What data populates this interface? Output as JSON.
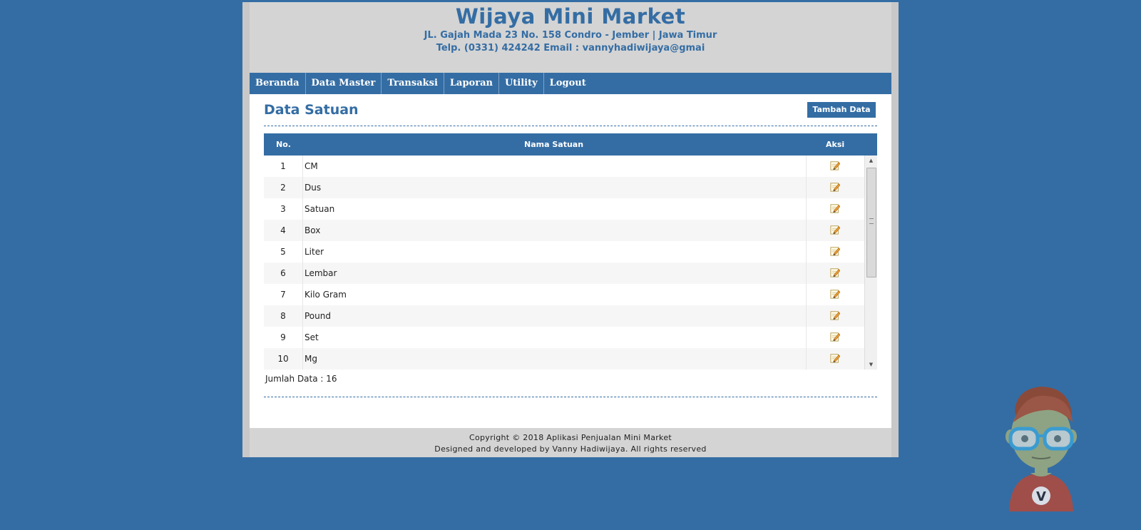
{
  "header": {
    "title": "Wijaya Mini Market",
    "address": "JL. Gajah Mada 23 No. 158 Condro - Jember | Jawa Timur",
    "contact": "Telp. (0331) 424242 Email : vannyhadiwijaya@gmai"
  },
  "nav": [
    "Beranda",
    "Data Master",
    "Transaksi",
    "Laporan",
    "Utility",
    "Logout"
  ],
  "page": {
    "title": "Data Satuan",
    "add_button": "Tambah Data"
  },
  "table": {
    "columns": [
      "No.",
      "Nama Satuan",
      "Aksi"
    ],
    "rows": [
      {
        "no": "1",
        "name": "CM"
      },
      {
        "no": "2",
        "name": "Dus"
      },
      {
        "no": "3",
        "name": "Satuan"
      },
      {
        "no": "4",
        "name": "Box"
      },
      {
        "no": "5",
        "name": "Liter"
      },
      {
        "no": "6",
        "name": "Lembar"
      },
      {
        "no": "7",
        "name": "Kilo Gram"
      },
      {
        "no": "8",
        "name": "Pound"
      },
      {
        "no": "9",
        "name": "Set"
      },
      {
        "no": "10",
        "name": "Mg"
      }
    ]
  },
  "summary": "Jumlah Data : 16",
  "footer": {
    "line1": "Copyright © 2018 Aplikasi Penjualan Mini Market",
    "line2": "Designed and developed by Vanny Hadiwijaya. All rights reserved"
  },
  "avatar_letter": "V",
  "colors": {
    "accent": "#346da4",
    "header_bg": "#d4d4d4"
  }
}
